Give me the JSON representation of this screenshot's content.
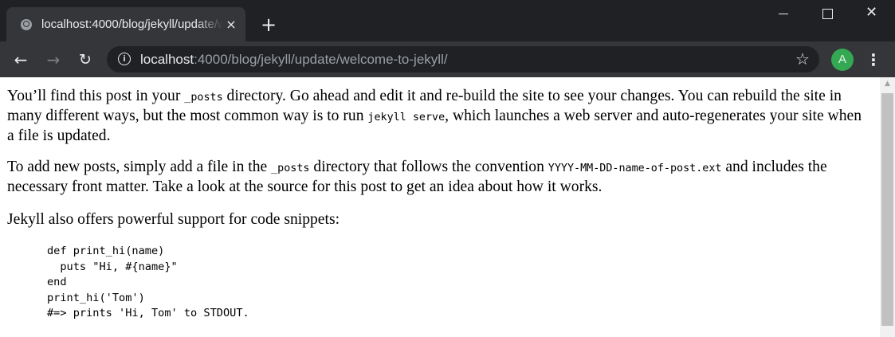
{
  "tab": {
    "title": "localhost:4000/blog/jekyll/update/welcome-to-jekyll/",
    "close_icon": "×",
    "new_tab_icon": "+"
  },
  "window": {
    "minimize_icon": "minimize-icon",
    "maximize_icon": "maximize-icon",
    "close_icon": "✕"
  },
  "toolbar": {
    "back_icon": "←",
    "forward_icon": "→",
    "reload_icon": "↻",
    "info_icon": "i",
    "url_host": "localhost",
    "url_rest": ":4000/blog/jekyll/update/welcome-to-jekyll/",
    "bookmark_icon": "☆",
    "avatar_letter": "A",
    "menu_icon": "⋮"
  },
  "page": {
    "p1": {
      "t1": "You’ll find this post in your ",
      "c1": "_posts",
      "t2": " directory. Go ahead and edit it and re-build the site to see your changes. You can rebuild the site in many different ways, but the most common way is to run ",
      "c2": "jekyll serve",
      "t3": ", which launches a web server and auto-regenerates your site when a file is updated."
    },
    "p2": {
      "t1": "To add new posts, simply add a file in the ",
      "c1": "_posts",
      "t2": " directory that follows the convention ",
      "c2": "YYYY-MM-DD-name-of-post.ext",
      "t3": " and includes the necessary front matter. Take a look at the source for this post to get an idea about how it works."
    },
    "p3": "Jekyll also offers powerful support for code snippets:",
    "code": "def print_hi(name)\n  puts \"Hi, #{name}\"\nend\nprint_hi('Tom')\n#=> prints 'Hi, Tom' to STDOUT."
  },
  "scrollbar": {
    "up_arrow": "▲"
  },
  "colors": {
    "titlebar": "#202124",
    "toolbar": "#35363a",
    "avatar": "#34a853"
  }
}
